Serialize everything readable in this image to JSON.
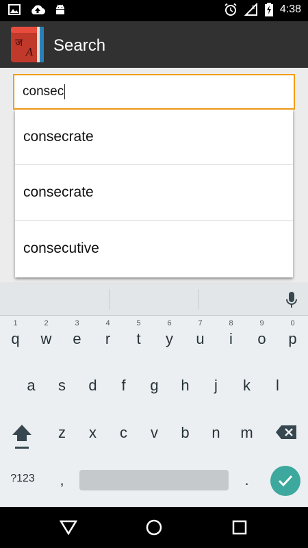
{
  "statusbar": {
    "time": "4:38"
  },
  "appbar": {
    "title": "Search",
    "logo_letters": [
      "ज",
      "A"
    ]
  },
  "search": {
    "value": "consec"
  },
  "suggestions": [
    "consecrate",
    "consecrate",
    "consecutive"
  ],
  "keyboard": {
    "row1": [
      {
        "k": "q",
        "h": "1"
      },
      {
        "k": "w",
        "h": "2"
      },
      {
        "k": "e",
        "h": "3"
      },
      {
        "k": "r",
        "h": "4"
      },
      {
        "k": "t",
        "h": "5"
      },
      {
        "k": "y",
        "h": "6"
      },
      {
        "k": "u",
        "h": "7"
      },
      {
        "k": "i",
        "h": "8"
      },
      {
        "k": "o",
        "h": "9"
      },
      {
        "k": "p",
        "h": "0"
      }
    ],
    "row2": [
      "a",
      "s",
      "d",
      "f",
      "g",
      "h",
      "j",
      "k",
      "l"
    ],
    "row3": [
      "z",
      "x",
      "c",
      "v",
      "b",
      "n",
      "m"
    ],
    "symbols_label": "?123",
    "comma": ",",
    "period": "."
  },
  "colors": {
    "accent": "#f39c12",
    "enter": "#3da89d",
    "appbar": "#313131"
  }
}
